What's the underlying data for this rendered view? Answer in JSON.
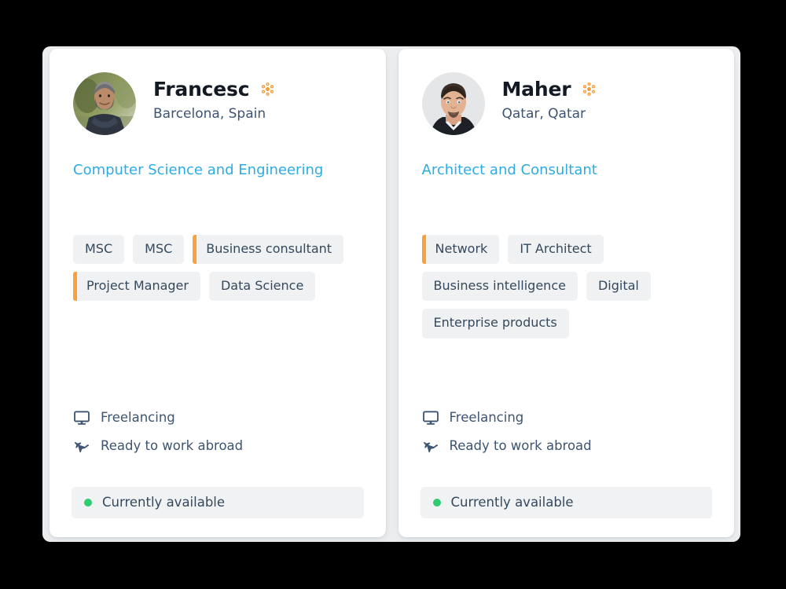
{
  "theme": {
    "page_background": "#000000",
    "panel_background": "#eceef0",
    "card_background": "#ffffff",
    "accent_blue": "#2cace3",
    "accent_orange": "#f9a13a",
    "text_dark": "#131a24",
    "text_muted": "#3d5472",
    "tag_background": "#f0f1f2",
    "status_green": "#2ecc71"
  },
  "cards": [
    {
      "avatar": {
        "icon": "avatar-photo",
        "alt": "Man with dark scarf outdoors"
      },
      "name": "Francesc",
      "verified_icon": "verified-flower-icon",
      "location": "Barcelona, Spain",
      "headline": "Computer Science and Engineering",
      "tags": [
        {
          "label": "MSC",
          "highlighted": false
        },
        {
          "label": "MSC",
          "highlighted": false
        },
        {
          "label": "Business consultant",
          "highlighted": true
        },
        {
          "label": "Project Manager",
          "highlighted": true
        },
        {
          "label": "Data Science",
          "highlighted": false
        }
      ],
      "attributes": [
        {
          "icon": "monitor-icon",
          "label": "Freelancing"
        },
        {
          "icon": "airplane-icon",
          "label": "Ready to work abroad"
        }
      ],
      "availability": {
        "status_icon": "green-dot-icon",
        "label": "Currently available"
      }
    },
    {
      "avatar": {
        "icon": "avatar-photo",
        "alt": "Man with short dark hair and goatee"
      },
      "name": "Maher",
      "verified_icon": "verified-flower-icon",
      "location": "Qatar, Qatar",
      "headline": "Architect and Consultant",
      "tags": [
        {
          "label": "Network",
          "highlighted": true
        },
        {
          "label": "IT Architect",
          "highlighted": false
        },
        {
          "label": "Business intelligence",
          "highlighted": false
        },
        {
          "label": "Digital",
          "highlighted": false
        },
        {
          "label": "Enterprise products",
          "highlighted": false
        }
      ],
      "attributes": [
        {
          "icon": "monitor-icon",
          "label": "Freelancing"
        },
        {
          "icon": "airplane-icon",
          "label": "Ready to work abroad"
        }
      ],
      "availability": {
        "status_icon": "green-dot-icon",
        "label": "Currently available"
      }
    }
  ]
}
